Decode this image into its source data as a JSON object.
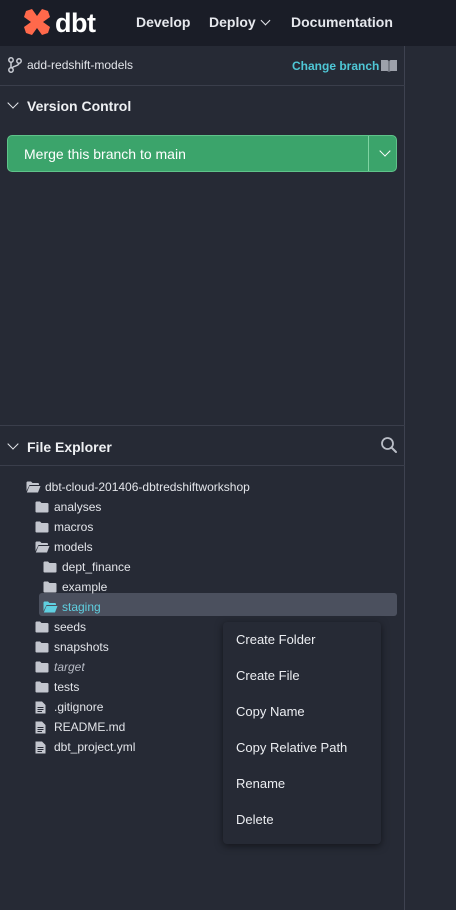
{
  "header": {
    "logo_text": "dbt",
    "brand_color": "#ff694b",
    "nav": [
      {
        "label": "Develop"
      },
      {
        "label": "Deploy",
        "has_dropdown": true
      },
      {
        "label": "Documentation"
      }
    ]
  },
  "branch": {
    "name": "add-redshift-models",
    "change_label": "Change branch",
    "icons": [
      "branch-icon",
      "book-icon"
    ]
  },
  "version_control": {
    "title": "Version Control",
    "merge_button_label": "Merge this branch to main",
    "button_color": "#3ba46b"
  },
  "file_explorer": {
    "title": "File Explorer",
    "search_icon": "search-icon",
    "tree": [
      {
        "label": "dbt-cloud-201406-dbtredshiftworkshop",
        "type": "folder-open",
        "depth": 0
      },
      {
        "label": "analyses",
        "type": "folder",
        "depth": 1
      },
      {
        "label": "macros",
        "type": "folder",
        "depth": 1
      },
      {
        "label": "models",
        "type": "folder-open",
        "depth": 1
      },
      {
        "label": "dept_finance",
        "type": "folder",
        "depth": 2
      },
      {
        "label": "example",
        "type": "folder",
        "depth": 2
      },
      {
        "label": "staging",
        "type": "folder-open",
        "depth": 2,
        "selected": true
      },
      {
        "label": "seeds",
        "type": "folder",
        "depth": 1
      },
      {
        "label": "snapshots",
        "type": "folder",
        "depth": 1
      },
      {
        "label": "target",
        "type": "folder",
        "depth": 1,
        "italic": true
      },
      {
        "label": "tests",
        "type": "folder",
        "depth": 1
      },
      {
        "label": ".gitignore",
        "type": "file",
        "depth": 1
      },
      {
        "label": "README.md",
        "type": "file",
        "depth": 1
      },
      {
        "label": "dbt_project.yml",
        "type": "file",
        "depth": 1
      }
    ]
  },
  "context_menu": {
    "items": [
      "Create Folder",
      "Create File",
      "Copy Name",
      "Copy Relative Path",
      "Rename",
      "Delete"
    ]
  }
}
